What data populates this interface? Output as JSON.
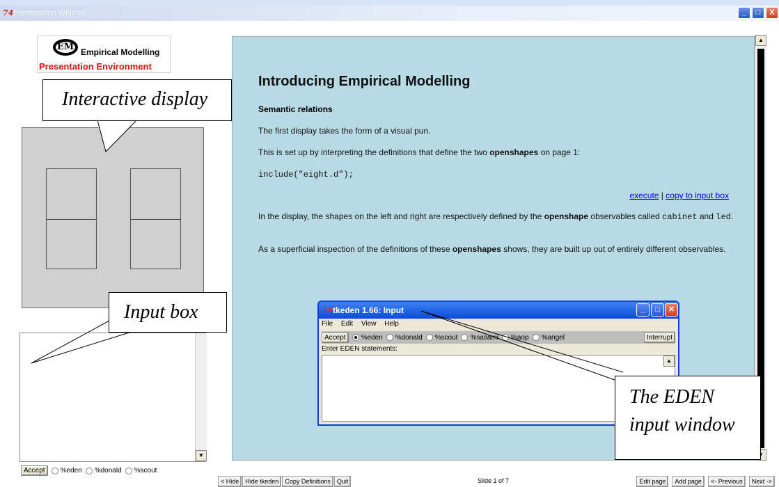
{
  "window": {
    "icon": "74",
    "title": "Presentation Window",
    "controls": {
      "minimize": "_",
      "maximize": "□",
      "close": "X"
    }
  },
  "logo": {
    "mark": "EM",
    "line1": "Empirical Modelling",
    "line2": "Presentation Environment"
  },
  "callouts": {
    "display": "Interactive display",
    "input": "Input box",
    "eden": [
      "The EDEN",
      "input window"
    ]
  },
  "left_panel": {
    "accept_label": "Accept",
    "radio_options": [
      "%eden",
      "%donald",
      "%scout"
    ],
    "selected": null
  },
  "content": {
    "heading": "Introducing Empirical Modelling",
    "subheading": "Semantic relations",
    "p1": "The first display takes the form of a visual pun.",
    "p2_a": "This is set up by interpreting the definitions that define the two ",
    "p2_b": "openshapes",
    "p2_c": " on page 1:",
    "code": "include(\"eight.d\");",
    "link_execute": "execute",
    "link_sep": " | ",
    "link_copy": "copy to input box",
    "p3_a": "In the display, the shapes on the left and right are respectively defined by the ",
    "p3_b": "openshape",
    "p3_c": " observables called ",
    "p3_code1": "cabinet",
    "p3_d": " and ",
    "p3_code2": "led",
    "p3_e": ".",
    "p4_a": "As a superficial inspection of the definitions of these ",
    "p4_b": "openshapes",
    "p4_c": " shows, they are built up out of entirely different observables."
  },
  "eden_window": {
    "icon": "74",
    "title": "tkeden 1.66: Input",
    "menu": [
      "File",
      "Edit",
      "View",
      "Help"
    ],
    "accept_label": "Accept",
    "radio_options": [
      "%eden",
      "%donald",
      "%scout",
      "%sasami",
      "%aop",
      "%angel"
    ],
    "selected": "%eden",
    "interrupt_label": "Interrupt",
    "prompt": "Enter EDEN statements:"
  },
  "bottom_bar": {
    "left_buttons": [
      "< Hide",
      "Hide tkeden",
      "Copy Definitions",
      "Quit"
    ],
    "slide_status": "Slide 1 of 7",
    "right_buttons": [
      "Edit page",
      "Add page",
      "<- Previous",
      "Next ->"
    ]
  }
}
